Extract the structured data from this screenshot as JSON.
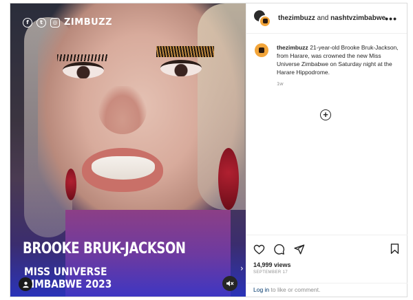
{
  "media": {
    "brand_icons": [
      "facebook-icon",
      "twitter-icon",
      "instagram-icon"
    ],
    "brand_glyphs": {
      "facebook": "f",
      "twitter": "t",
      "instagram": "◎"
    },
    "brand_name": "ZIMBUZZ",
    "headline": "BROOKE BRUK-JACKSON",
    "subline1": "MISS UNIVERSE",
    "subline2": "ZIMBABWE 2023",
    "next_glyph": "›"
  },
  "post": {
    "header": {
      "primary_user": "thezimbuzz",
      "and_text": "and",
      "collab_user": "nashtvzimbabwe",
      "more_glyph": "•••"
    },
    "caption": {
      "user": "thezimbuzz",
      "text": "21-year-old Brooke Bruk-Jackson, from Harare, was crowned the new Miss Universe Zimbabwe on Saturday night at the Harare Hippodrome.",
      "time": "1w"
    },
    "add_comment_glyph": "+",
    "views": "14,999 views",
    "date": "SEPTEMBER 17",
    "login": {
      "link": "Log in",
      "rest": " to like or comment."
    }
  },
  "colors": {
    "link": "#00376b",
    "muted": "#8e8e8e",
    "text": "#262626",
    "border": "#dbdbdb"
  }
}
